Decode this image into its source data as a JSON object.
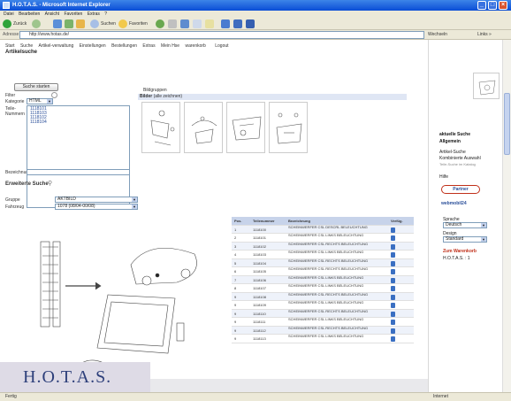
{
  "window": {
    "title": "H.O.T.A.S. - Microsoft Internet Explorer"
  },
  "menu": [
    "Datei",
    "Bearbeiten",
    "Ansicht",
    "Favoriten",
    "Extras",
    "?"
  ],
  "toolbar": {
    "back": "Zurück",
    "search": "Suchen",
    "favorites": "Favoriten"
  },
  "address": {
    "label": "Adresse",
    "url": "http://www.hotas.de/",
    "go": "Wechseln zu",
    "links": "Links »"
  },
  "nav": [
    "Start",
    "Suche",
    "Artikel-verwaltung",
    "Einstellungen",
    "Bestellungen",
    "Extras",
    "Mein Hse",
    "warenkorb",
    "Logout"
  ],
  "page": {
    "title": "Artikelsuche"
  },
  "form": {
    "search_button": "Suche starten",
    "filter_label": "Filter",
    "kategorie_label": "Kategorie",
    "kategorie_value": "HTML",
    "teile_label": "Teile-",
    "nummern_label": "Nummern",
    "part_numbers": [
      "1118101",
      "1118103",
      "1118102",
      "1118104"
    ],
    "bezeichnung_label": "Bezeichnung",
    "extended_title": "Erweiterte Suche",
    "gruppe_label": "Gruppe",
    "gruppe_value": "AKTBILD",
    "fahrzeug_label": "Fahrzeug",
    "fahrzeug_value": "1078 (08/04-00/08)"
  },
  "images": {
    "title": "Bildgruppen",
    "header_bold": "Bilder",
    "header_rest": "(alle zeichnen)"
  },
  "table": {
    "headers": [
      "Pos.",
      "Teilenummer",
      "Bezeichnung",
      "Verfüg."
    ],
    "rows": [
      {
        "pos": "1",
        "nr": "1118100",
        "desc": "SCHEINWERFER CSL DESCRL BELEUCHTUNG"
      },
      {
        "pos": "2",
        "nr": "1118101",
        "desc": "SCHEINWERFER CSL LINKS BELEUCHTUNG"
      },
      {
        "pos": "3",
        "nr": "1118102",
        "desc": "SCHEINWERFER CSL RECHTS BELEUCHTUNG"
      },
      {
        "pos": "4",
        "nr": "1118103",
        "desc": "SCHEINWERFER CSL LINKS BELEUCHTUNG"
      },
      {
        "pos": "5",
        "nr": "1118104",
        "desc": "SCHEINWERFER CSL RECHTS BELEUCHTUNG"
      },
      {
        "pos": "6",
        "nr": "1118105",
        "desc": "SCHEINWERFER CSL RECHTS BELEUCHTUNG"
      },
      {
        "pos": "7",
        "nr": "1118106",
        "desc": "SCHEINWERFER CSL LINKS BELEUCHTUNG"
      },
      {
        "pos": "8",
        "nr": "1118107",
        "desc": "SCHEINWERFER CSL LINKS BELEUCHTUNG"
      },
      {
        "pos": "9",
        "nr": "1118108",
        "desc": "SCHEINWERFER CSL RECHTS BELEUCHTUNG"
      },
      {
        "pos": "9",
        "nr": "1118109",
        "desc": "SCHEINWERFER CSL LINKS BELEUCHTUNG"
      },
      {
        "pos": "9",
        "nr": "1118110",
        "desc": "SCHEINWERFER CSL RECHTS BELEUCHTUNG"
      },
      {
        "pos": "9",
        "nr": "1118111",
        "desc": "SCHEINWERFER CSL LINKS BELEUCHTUNG"
      },
      {
        "pos": "9",
        "nr": "1118112",
        "desc": "SCHEINWERFER CSL RECHTS BELEUCHTUNG"
      },
      {
        "pos": "9",
        "nr": "1118113",
        "desc": "SCHEINWERFER CSL LINKS BELEUCHTUNG"
      }
    ]
  },
  "sidebar": {
    "links": [
      "aktuelle Suche",
      "Allgemein",
      "Artikel-Suche",
      "Kombinierte Auswahl",
      "Hilfe"
    ],
    "links_note": "Teile-Suche im Katalog",
    "logo1": "Partner",
    "logo2": "webmobil24",
    "sprache_label": "Sprache",
    "sprache_value": "Deutsch",
    "design_label": "Design",
    "design_value": "Standard",
    "cart_link": "Zum Warenkorb",
    "counter": "H.O.T.A.S. : 1"
  },
  "brand": {
    "logo_text": "H.O.T.A.S."
  },
  "status": {
    "left": "Fertig",
    "zone": "Internet"
  }
}
